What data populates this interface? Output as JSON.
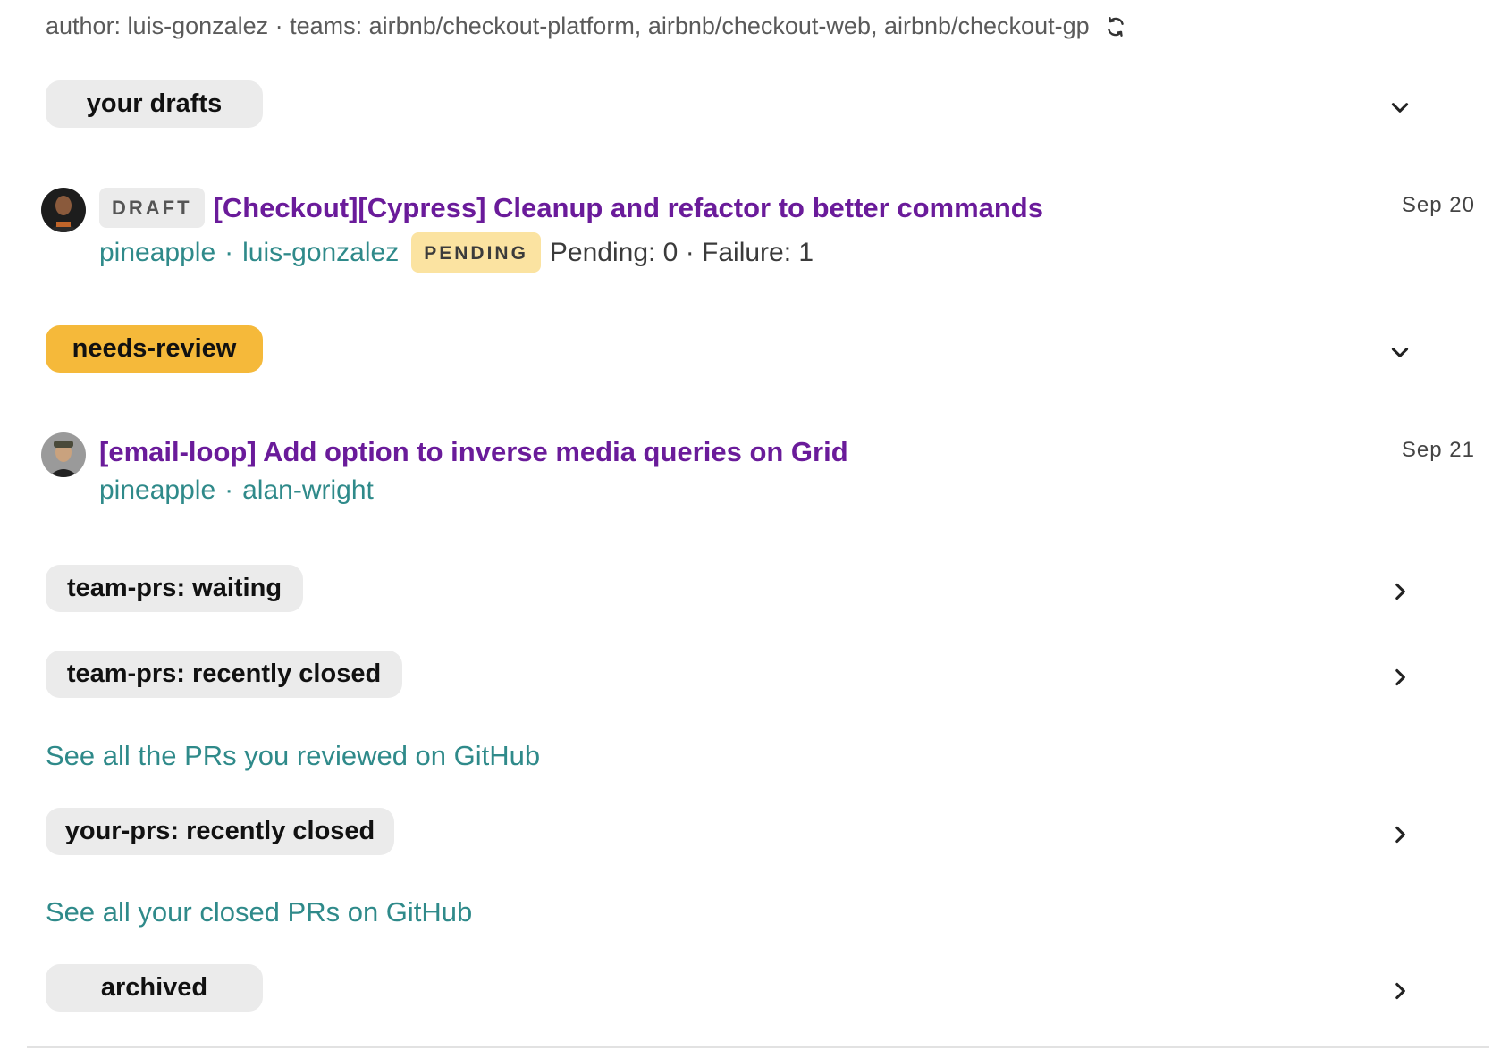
{
  "header": {
    "author_line": "author: luis-gonzalez · teams: airbnb/checkout-platform, airbnb/checkout-web, airbnb/checkout-gp",
    "refresh_icon": "refresh-icon"
  },
  "sections": {
    "your_drafts": {
      "label": "your drafts",
      "expanded": true
    },
    "needs_review": {
      "label": "needs-review",
      "expanded": true,
      "color": "#f5b93a"
    },
    "team_prs_waiting": {
      "label": "team-prs: waiting",
      "expanded": false
    },
    "team_prs_recently_closed": {
      "label": "team-prs: recently closed",
      "expanded": false
    },
    "your_prs_recently_closed": {
      "label": "your-prs: recently closed",
      "expanded": false
    },
    "archived": {
      "label": "archived",
      "expanded": false
    }
  },
  "draft_pr": {
    "badge": "DRAFT",
    "title": "[Checkout][Cypress] Cleanup and refactor to better commands",
    "repo": "pineapple",
    "separator": "·",
    "author": "luis-gonzalez",
    "status_badge": "PENDING",
    "status_text": "Pending: 0 · Failure: 1",
    "date": "Sep 20"
  },
  "review_pr": {
    "title": "[email-loop] Add option to inverse media queries on Grid",
    "repo": "pineapple",
    "separator": "·",
    "author": "alan-wright",
    "date": "Sep 21"
  },
  "links": {
    "reviewed_on_github": "See all the PRs you reviewed on GitHub",
    "closed_on_github": "See all your closed PRs on GitHub"
  },
  "colors": {
    "title_purple": "#6a1b9a",
    "link_teal": "#2f8a8a",
    "needs_review_yellow": "#f5b93a",
    "pending_badge": "#fbe3a1"
  }
}
